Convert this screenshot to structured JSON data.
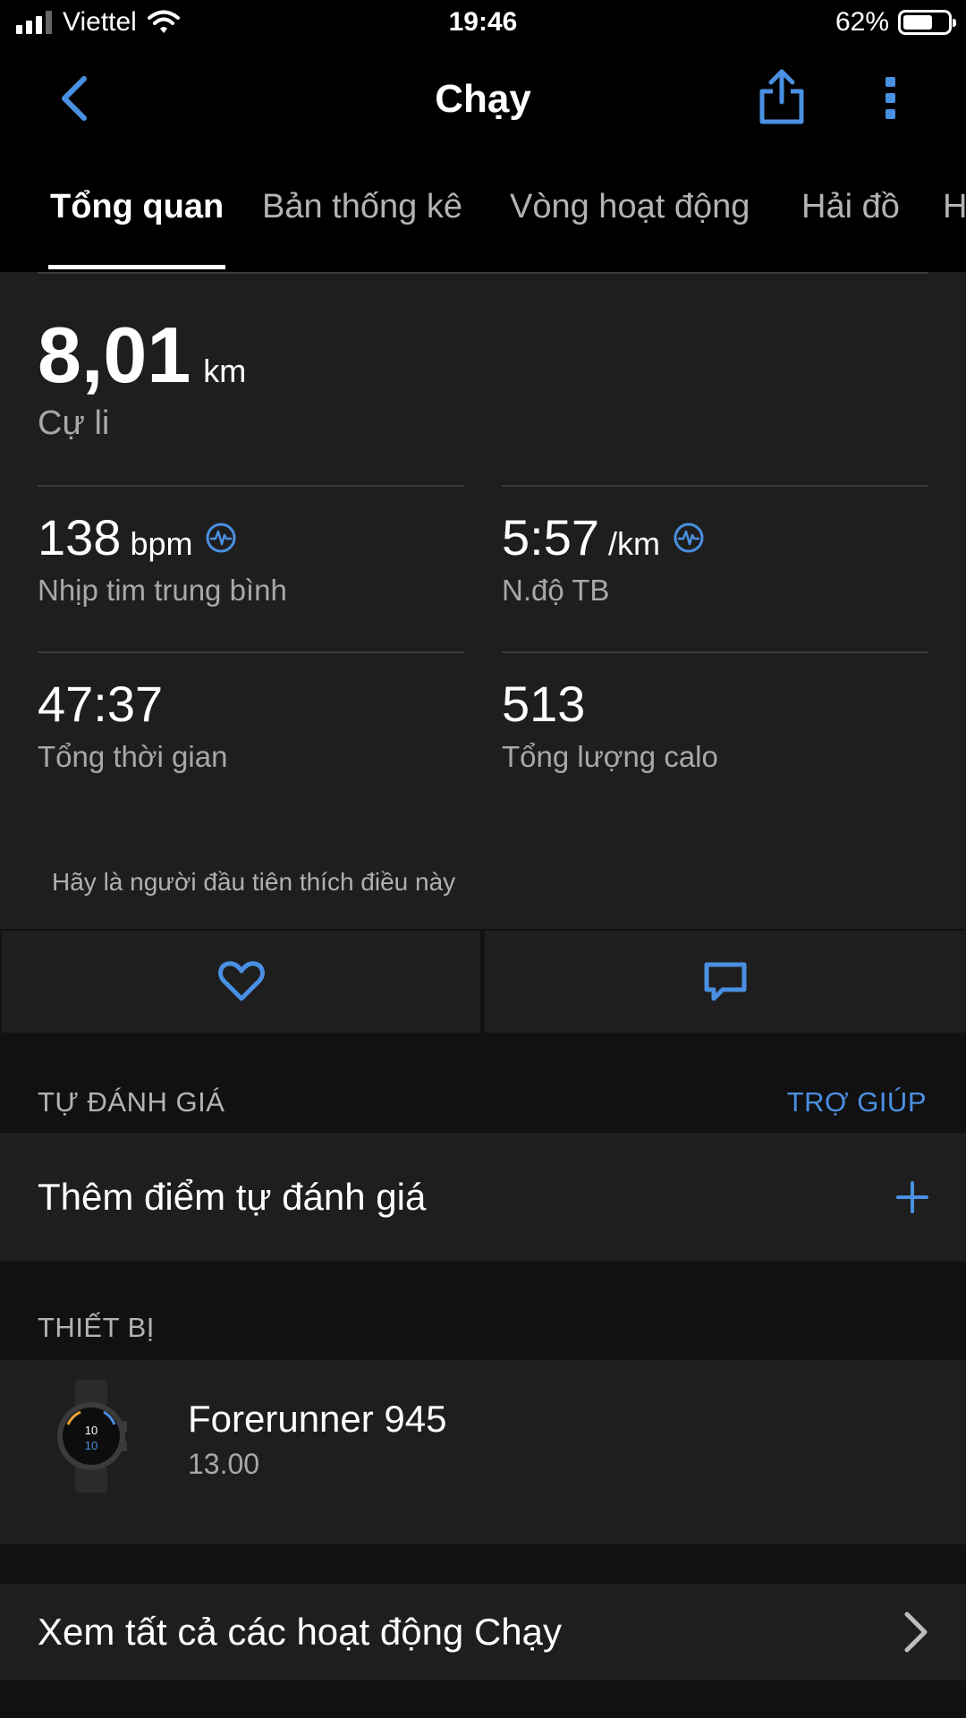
{
  "status_bar": {
    "carrier": "Viettel",
    "time": "19:46",
    "battery_percent": "62%",
    "battery_level": 0.62,
    "signal_bars": 3
  },
  "nav": {
    "title": "Chạy",
    "back_icon": "chevron-left-icon",
    "share_icon": "share-icon",
    "more_icon": "more-vertical-icon"
  },
  "tabs": [
    {
      "label": "Tổng quan",
      "active": true
    },
    {
      "label": "Bản thống kê"
    },
    {
      "label": "Vòng hoạt động"
    },
    {
      "label": "Hải đồ"
    },
    {
      "label": "H"
    }
  ],
  "overview": {
    "distance": {
      "value": "8,01",
      "unit": "km",
      "label": "Cự li"
    },
    "heart_rate": {
      "value": "138",
      "unit": "bpm",
      "label": "Nhịp tim trung bình"
    },
    "pace": {
      "value": "5:57",
      "unit": "/km",
      "label": "N.độ TB"
    },
    "total_time": {
      "value": "47:37",
      "label": "Tổng thời gian"
    },
    "calories": {
      "value": "513",
      "label": "Tổng lượng calo"
    },
    "like_hint": "Hãy là người đầu tiên thích điều này"
  },
  "actions": {
    "like_icon": "heart-icon",
    "comment_icon": "comment-icon"
  },
  "self_assessment": {
    "heading": "TỰ ĐÁNH GIÁ",
    "help": "TRỢ GIÚP",
    "add_label": "Thêm điểm tự đánh giá"
  },
  "device": {
    "heading": "THIẾT BỊ",
    "name": "Forerunner 945",
    "version": "13.00",
    "watch_face": "10"
  },
  "view_all": {
    "label": "Xem tất cả các hoạt động Chạy"
  },
  "colors": {
    "accent": "#4a90e2",
    "background": "#111111",
    "card": "#1e1e1f",
    "secondary_text": "#a8a8aa"
  }
}
